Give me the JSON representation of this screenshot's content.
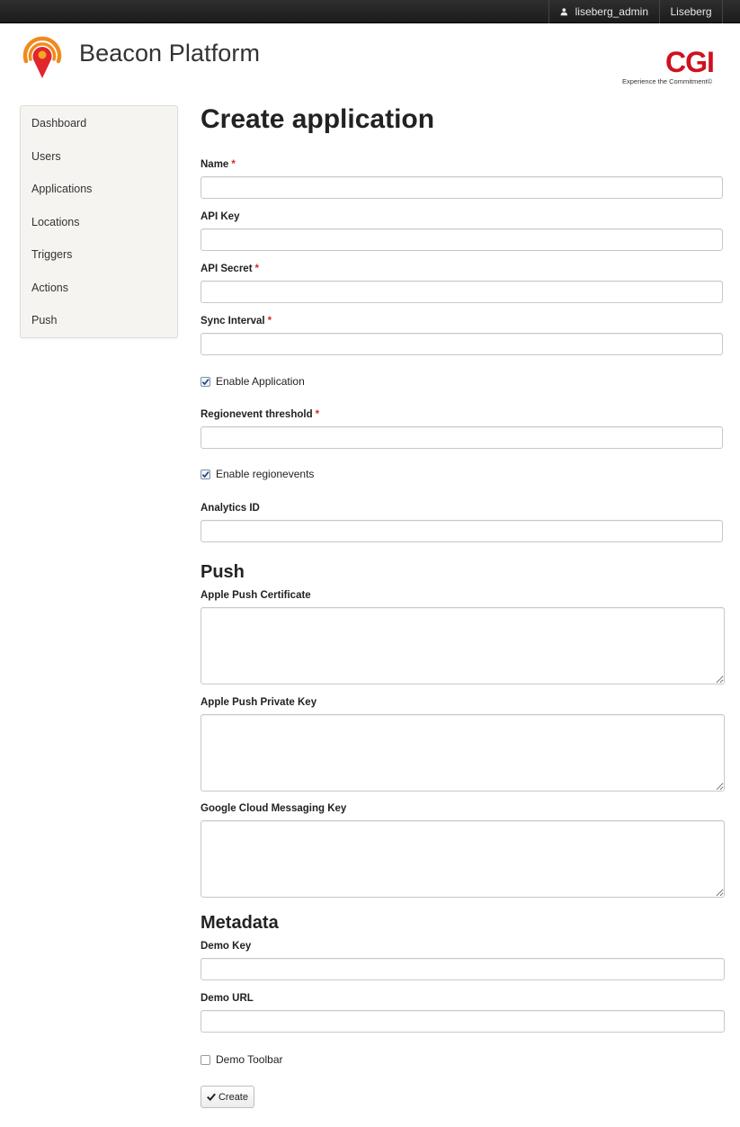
{
  "topbar": {
    "username": "liseberg_admin",
    "organization": "Liseberg"
  },
  "header": {
    "brand_title": "Beacon Platform",
    "partner_logo": "CGI",
    "partner_tagline": "Experience the Commitment©"
  },
  "colors": {
    "partner_red": "#d0101e",
    "logo_orange": "#f08a1c",
    "logo_red": "#e1262d",
    "required_star": "#c9302c"
  },
  "sidebar": {
    "items": [
      {
        "label": "Dashboard"
      },
      {
        "label": "Users"
      },
      {
        "label": "Applications"
      },
      {
        "label": "Locations"
      },
      {
        "label": "Triggers"
      },
      {
        "label": "Actions"
      },
      {
        "label": "Push"
      }
    ]
  },
  "form": {
    "title": "Create application",
    "required_marker": "*",
    "name": {
      "label": "Name",
      "value": ""
    },
    "api_key": {
      "label": "API Key",
      "value": ""
    },
    "api_secret": {
      "label": "API Secret",
      "value": ""
    },
    "sync_interval": {
      "label": "Sync Interval",
      "value": ""
    },
    "enable_application": {
      "label": "Enable Application",
      "checked": true
    },
    "regionevent_threshold": {
      "label": "Regionevent threshold",
      "value": ""
    },
    "enable_regionevents": {
      "label": "Enable regionevents",
      "checked": true
    },
    "analytics_id": {
      "label": "Analytics ID",
      "value": ""
    },
    "push": {
      "title": "Push",
      "apple_push_certificate": {
        "label": "Apple Push Certificate",
        "value": ""
      },
      "apple_push_private_key": {
        "label": "Apple Push Private Key",
        "value": ""
      },
      "google_cloud_messaging_key": {
        "label": "Google Cloud Messaging Key",
        "value": ""
      }
    },
    "metadata": {
      "title": "Metadata",
      "demo_key": {
        "label": "Demo Key",
        "value": ""
      },
      "demo_url": {
        "label": "Demo URL",
        "value": ""
      },
      "demo_toolbar": {
        "label": "Demo Toolbar",
        "checked": false
      }
    },
    "create_label": "Create"
  },
  "icons": {
    "user": "user-icon",
    "logo": "beacon-pin-icon",
    "checkmark": "check-icon"
  }
}
